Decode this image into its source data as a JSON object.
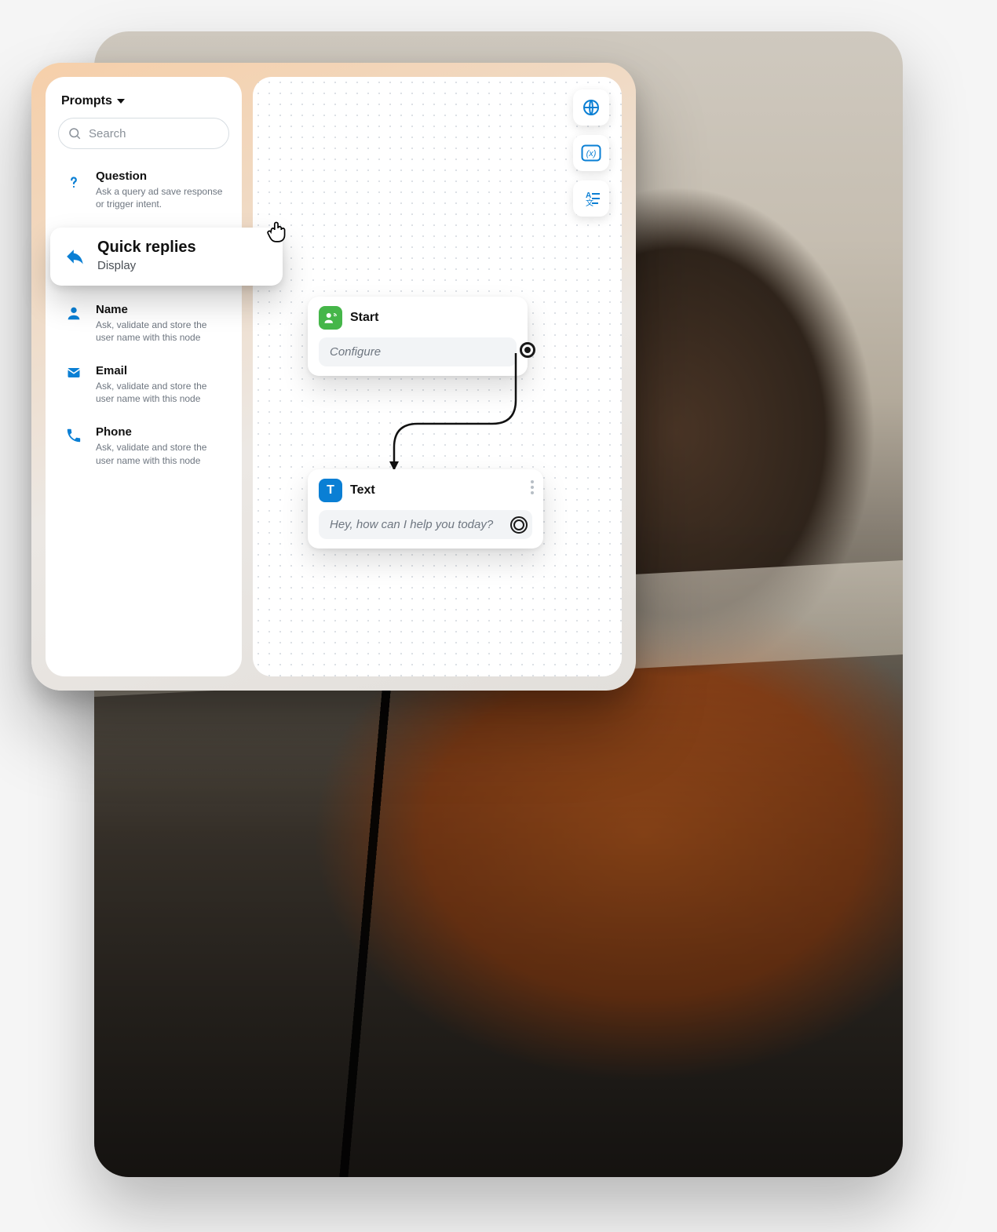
{
  "colors": {
    "accent_blue": "#0a7fd4",
    "accent_green": "#45b649"
  },
  "sidebar": {
    "header": "Prompts",
    "search_placeholder": "Search",
    "items": [
      {
        "title": "Question",
        "desc": "Ask a query ad save response or trigger intent."
      },
      {
        "title": "Quick replies",
        "desc": "Display"
      },
      {
        "title": "Name",
        "desc": "Ask, validate and store the user name with this node"
      },
      {
        "title": "Email",
        "desc": "Ask, validate and store the user name with this node"
      },
      {
        "title": "Phone",
        "desc": "Ask, validate and store the user name with this node"
      }
    ]
  },
  "canvas": {
    "nodes": {
      "start": {
        "label": "Start",
        "body": "Configure",
        "icon_letter": ""
      },
      "text": {
        "label": "Text",
        "body": "Hey, how can I help you today?",
        "icon_letter": "T"
      }
    }
  }
}
